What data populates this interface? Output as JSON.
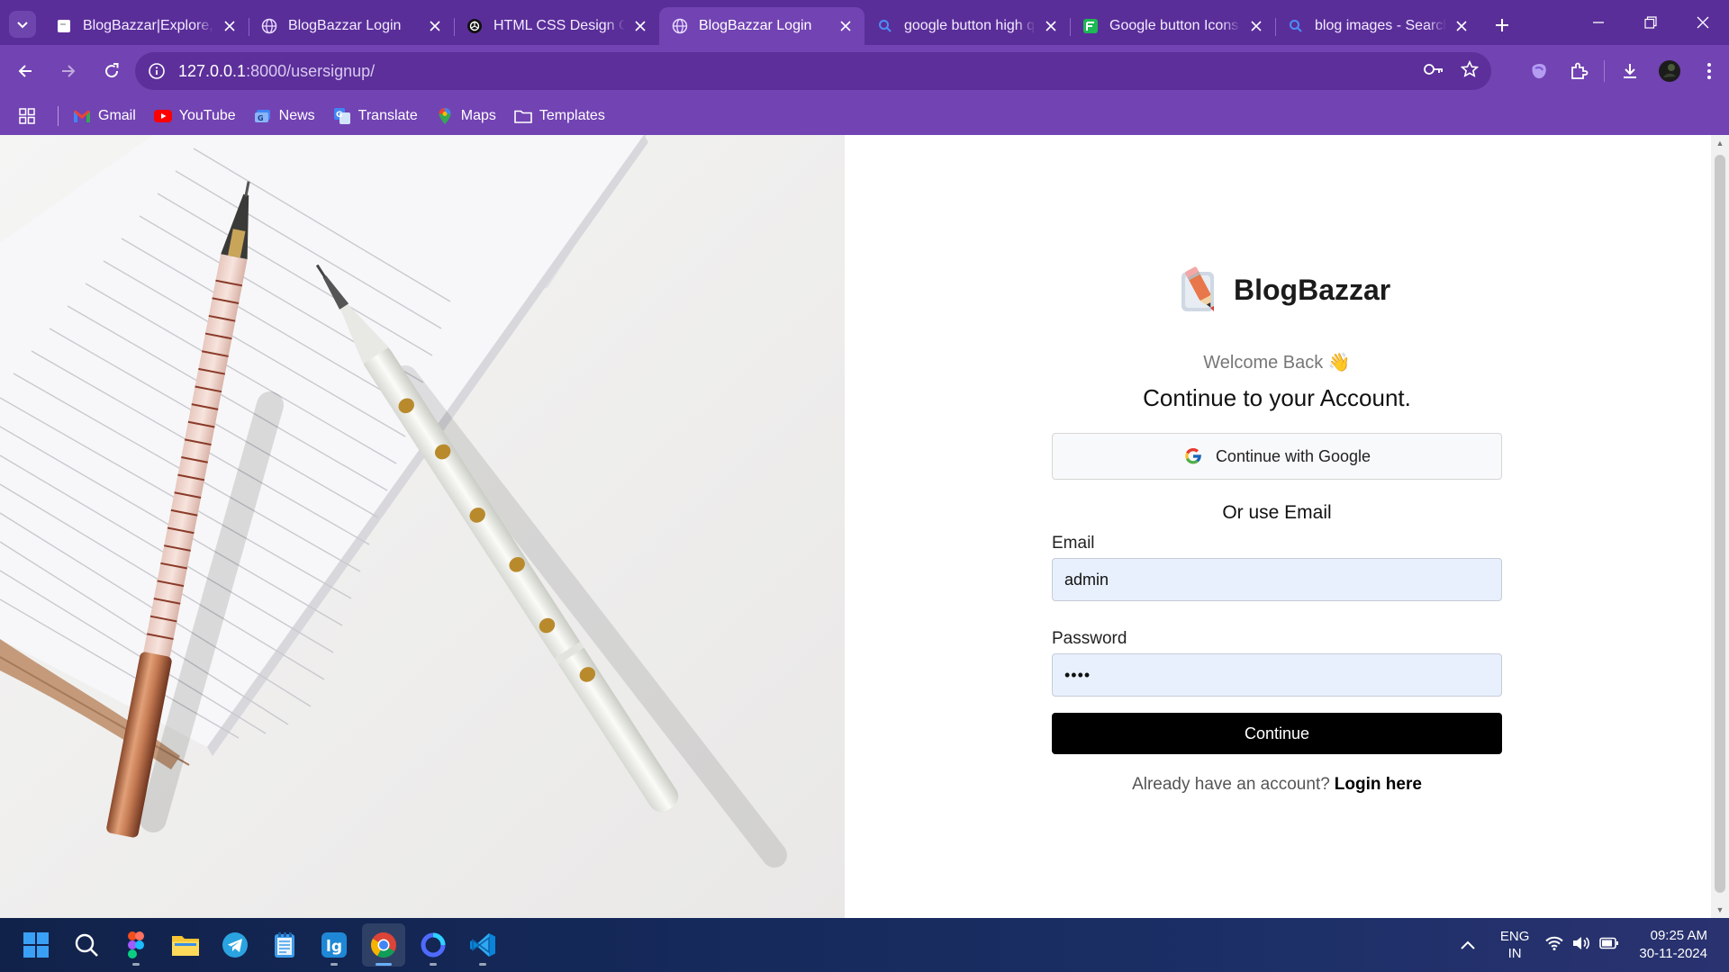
{
  "browser": {
    "tabs": [
      {
        "title": "BlogBazzar|Explore, Discover",
        "favicon": "page-icon",
        "active": false
      },
      {
        "title": "BlogBazzar Login",
        "favicon": "globe-icon",
        "active": false
      },
      {
        "title": "HTML CSS Design Code",
        "favicon": "openai-icon",
        "active": false
      },
      {
        "title": "BlogBazzar Login",
        "favicon": "globe-icon",
        "active": true
      },
      {
        "title": "google button high quality",
        "favicon": "search-icon",
        "active": false
      },
      {
        "title": "Google button Icons",
        "favicon": "flaticon-icon",
        "active": false
      },
      {
        "title": "blog images - Search",
        "favicon": "search-icon",
        "active": false
      }
    ],
    "address": {
      "host": "127.0.0.1",
      "path": ":8000/usersignup/"
    },
    "bookmarks": [
      {
        "label": "Gmail",
        "icon": "gmail-icon"
      },
      {
        "label": "YouTube",
        "icon": "youtube-icon"
      },
      {
        "label": "News",
        "icon": "news-icon"
      },
      {
        "label": "Translate",
        "icon": "translate-icon"
      },
      {
        "label": "Maps",
        "icon": "maps-icon"
      },
      {
        "label": "Templates",
        "icon": "folder-icon"
      }
    ],
    "colors": {
      "frame": "#5a2e99",
      "toolbar": "#7243b3",
      "omnibox": "#5c2f9a"
    }
  },
  "page": {
    "brand": "BlogBazzar",
    "welcome": "Welcome Back 👋",
    "heading": "Continue to your Account.",
    "google_button": "Continue with Google",
    "or_use": "Or use Email",
    "email_label": "Email",
    "email_value": "admin",
    "password_label": "Password",
    "password_value": "••••",
    "continue_button": "Continue",
    "already_text": "Already have an account?",
    "login_link": "Login here"
  },
  "taskbar": {
    "apps": [
      "windows-start-icon",
      "search-icon",
      "figma-icon",
      "file-explorer-icon",
      "telegram-icon",
      "notepad-icon",
      "code-app-icon",
      "chrome-icon",
      "browser-circle-icon",
      "vscode-icon"
    ],
    "lang_line1": "ENG",
    "lang_line2": "IN",
    "time": "09:25 AM",
    "date": "30-11-2024"
  }
}
